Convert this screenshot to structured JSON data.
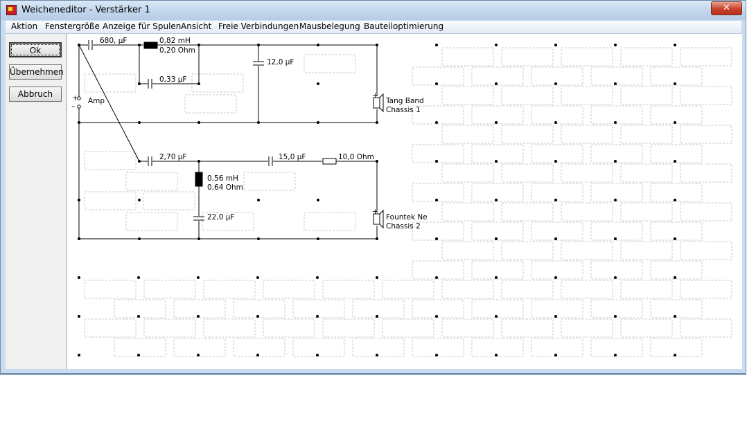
{
  "window": {
    "title": "Weicheneditor - Verstärker 1",
    "close_label": "✕"
  },
  "menu": {
    "items": [
      "Aktion",
      "Fenstergröße",
      "Anzeige für Spulen",
      "Ansicht",
      "Freie Verbindungen",
      "Mausbelegung",
      "Bauteiloptimierung"
    ]
  },
  "buttons": {
    "ok": "Ok",
    "apply": "Übernehmen",
    "cancel": "Abbruch"
  },
  "circuit": {
    "amp_label": "Amp",
    "plus": "+",
    "minus": "–",
    "tweeter": {
      "c1": "680, µF",
      "l1_value": "0,82 mH",
      "l1_res": "0,20 Ohm",
      "c2": "0,33 µF",
      "c3": "12,0 µF",
      "driver_line1": "Tang Band",
      "driver_line2": "Chassis 1"
    },
    "woofer": {
      "c1": "2,70 µF",
      "c2": "15,0 µF",
      "r1": "10,0 Ohm",
      "l1_value": "0,56 mH",
      "l1_res": "0,64 Ohm",
      "c3": "22,0 µF",
      "driver_line1": "Fountek Ne",
      "driver_line2": "Chassis 2"
    }
  }
}
